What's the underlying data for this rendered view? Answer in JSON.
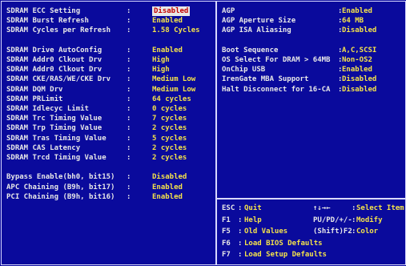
{
  "left_panel": {
    "rows": [
      {
        "label": "SDRAM  ECC Setting",
        "value": "Disabled",
        "selected": true
      },
      {
        "label": "SDRAM  Burst Refresh",
        "value": "Enabled"
      },
      {
        "label": "SDRAM  Cycles per Refresh",
        "value": "1.58 Cycles"
      },
      {
        "label": "",
        "value": ""
      },
      {
        "label": "SDRAM Drive AutoConfig",
        "value": "Enabled"
      },
      {
        "label": "SDRAM Addr0 Clkout Drv",
        "value": "High"
      },
      {
        "label": "SDRAM Addr0 Clkout Drv",
        "value": "High"
      },
      {
        "label": "SDRAM CKE/RAS/WE/CKE Drv",
        "value": "Medium Low"
      },
      {
        "label": "SDRAM DQM Drv",
        "value": "Medium Low"
      },
      {
        "label": "SDRAM PRLimit",
        "value": "64 cycles"
      },
      {
        "label": "SDRAM  Idlecyc Limit",
        "value": "0 cycles"
      },
      {
        "label": "SDRAM  Trc Timing Value",
        "value": "7 cycles"
      },
      {
        "label": "SDRAM  Trp Timing Value",
        "value": "2 cycles"
      },
      {
        "label": "SDRAM  Tras Timing Value",
        "value": "5 cycles"
      },
      {
        "label": "SDRAM  CAS Latency",
        "value": "2 cycles"
      },
      {
        "label": "SDRAM  Trcd Timing Value",
        "value": "2 cycles"
      },
      {
        "label": "",
        "value": ""
      },
      {
        "label": "Bypass Enable(bh0, bit15)",
        "value": "Disabled"
      },
      {
        "label": "APC Chaining (B9h, bit17)",
        "value": "Enabled"
      },
      {
        "label": "PCI Chaining (B9h, bit16)",
        "value": "Enabled"
      }
    ]
  },
  "right_panel": {
    "rows": [
      {
        "label": "AGP",
        "value": "Enabled"
      },
      {
        "label": "AGP Aperture Size",
        "value": "64 MB"
      },
      {
        "label": "AGP ISA Aliasing",
        "value": "Disabled"
      },
      {
        "label": "",
        "value": ""
      },
      {
        "label": "Boot Sequence",
        "value": "A,C,SCSI"
      },
      {
        "label": "OS Select For DRAM > 64MB",
        "value": "Non-OS2"
      },
      {
        "label": "OnChip USB",
        "value": "Enabled"
      },
      {
        "label": "IrenGate MBA Support",
        "value": "Disabled"
      },
      {
        "label": "Halt Disconnect for 16-CA",
        "value": "Disabled"
      }
    ]
  },
  "help_panel": {
    "rows": [
      {
        "key": "ESC",
        "desc": "Quit",
        "key2": "↑↓→←",
        "desc2": "Select Item"
      },
      {
        "key": "F1",
        "desc": "Help",
        "key2": "PU/PD/+/-",
        "desc2": "Modify"
      },
      {
        "key": "F5",
        "desc": "Old Values",
        "key2": "(Shift)F2",
        "desc2": "Color"
      },
      {
        "key": "F6",
        "desc": "Load BIOS  Defaults",
        "key2": "",
        "desc2": ""
      },
      {
        "key": "F7",
        "desc": "Load Setup Defaults",
        "key2": "",
        "desc2": ""
      }
    ]
  }
}
